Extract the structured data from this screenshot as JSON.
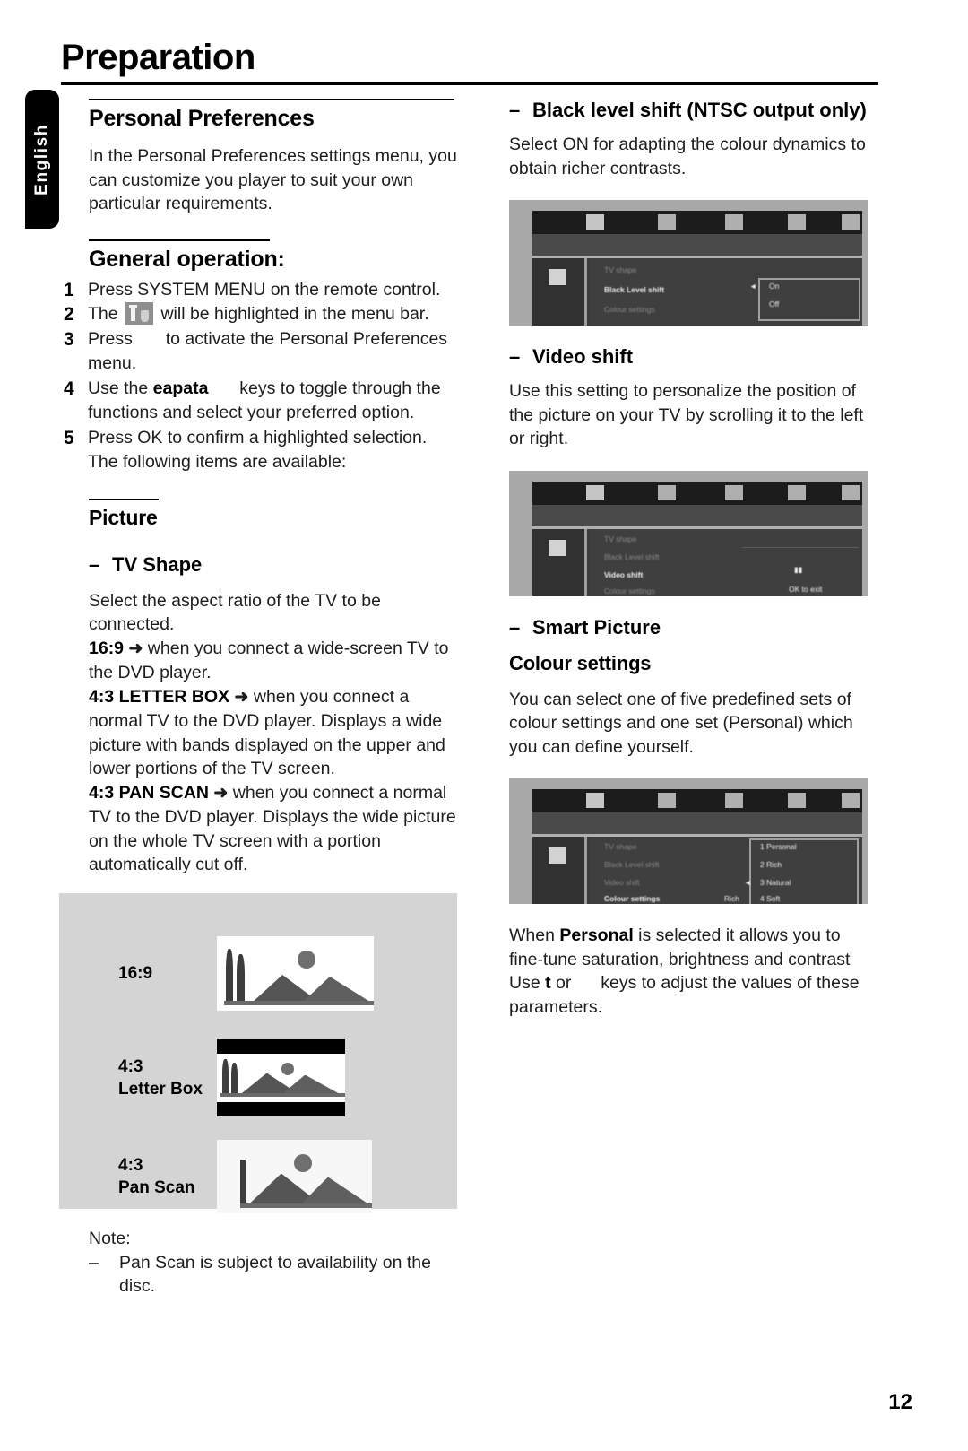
{
  "page": {
    "title": "Preparation",
    "language_tab": "English",
    "page_number": "12"
  },
  "left_column": {
    "personal_preferences": {
      "heading": "Personal Preferences",
      "body": "In the Personal Preferences settings menu, you can customize you player to suit your own particular requirements."
    },
    "general_operation": {
      "heading": "General operation:",
      "steps": [
        {
          "num": "1",
          "text": "Press SYSTEM MENU on the remote control."
        },
        {
          "num": "2",
          "pre": "The",
          "icon": "preferences-menu-icon",
          "post": "will be highlighted in the menu bar."
        },
        {
          "num": "3",
          "pre": "Press",
          "post": "to activate the Personal Preferences menu."
        },
        {
          "num": "4",
          "pre": "Use the",
          "bold": "eapata",
          "post": "keys to toggle through the functions and select your preferred option."
        },
        {
          "num": "5",
          "text": "Press OK to confirm a highlighted selection. The following items are available:"
        }
      ]
    },
    "picture": {
      "heading": "Picture",
      "tv_shape": {
        "dash": "–",
        "heading": "TV Shape",
        "intro": "Select the aspect ratio of the TV to be connected.",
        "options": [
          {
            "label": "16:9",
            "arrow": "➜",
            "text": "when you connect a wide-screen TV to the DVD player."
          },
          {
            "label": "4:3 LETTER BOX",
            "arrow": "➜",
            "text": "when you connect a normal TV to the DVD player. Displays a wide picture with bands displayed on the upper and lower portions of the TV screen."
          },
          {
            "label": "4:3 PAN SCAN",
            "arrow": "➜",
            "text": "when you connect a normal TV to the DVD player. Displays the wide picture on the whole TV screen with a portion automatically cut off."
          }
        ]
      },
      "figure": {
        "rows": [
          {
            "label_line1": "16:9",
            "label_line2": "",
            "mode": "wide"
          },
          {
            "label_line1": "4:3",
            "label_line2": "Letter Box",
            "mode": "letterbox"
          },
          {
            "label_line1": "4:3",
            "label_line2": "Pan Scan",
            "mode": "panscan"
          }
        ]
      },
      "note": {
        "title": "Note:",
        "dash": "–",
        "text": "Pan Scan is subject to availability on the disc."
      }
    }
  },
  "right_column": {
    "black_level_shift": {
      "dash": "–",
      "heading": "Black level shift (NTSC output only)",
      "body": "Select ON for adapting the colour dynamics to obtain richer contrasts.",
      "osd": {
        "menu_label": "Black Level shift",
        "value_1": "On",
        "value_2": "Off"
      }
    },
    "video_shift": {
      "dash": "–",
      "heading": "Video shift",
      "body": "Use this setting to personalize the position of the picture on your TV by scrolling it to the left or right.",
      "osd": {
        "menu_label": "Video shift",
        "hint": "OK to exit",
        "row_1": "TV shape",
        "row_2": "Black Level shift",
        "row_3": "Colour settings"
      }
    },
    "smart_picture": {
      "dash": "–",
      "heading": "Smart Picture",
      "subheading": "Colour settings",
      "body": "You can select one of five predefined sets of colour settings and one set (Personal) which you can define yourself.",
      "osd": {
        "menu_label": "Colour settings",
        "options": [
          "1 Personal",
          "2 Rich",
          "3 Natural",
          "4 Soft"
        ],
        "selected": "Rich"
      },
      "footer_pre": "When",
      "footer_bold": "Personal",
      "footer_post": "is selected it allows you to fine-tune saturation, brightness and contrast",
      "footer_line2_pre": "Use",
      "footer_line2_bold": "t",
      "footer_line2_mid": "or",
      "footer_line2_post": "keys to adjust the values of these parameters."
    }
  }
}
